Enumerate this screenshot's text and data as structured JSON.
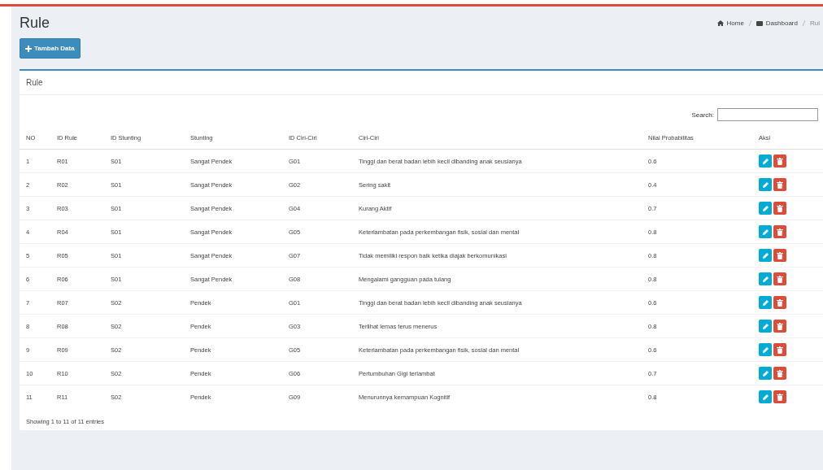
{
  "page_title": "Rule",
  "breadcrumb": [
    {
      "label": "Home"
    },
    {
      "label": "Dashboard"
    },
    {
      "label": "Rul"
    }
  ],
  "add_button": "Tambah Data",
  "box_title": "Rule",
  "search": {
    "label": "Search:"
  },
  "columns": [
    "NO",
    "ID Rule",
    "ID Stunting",
    "Stunting",
    "ID Ciri-Ciri",
    "Ciri-Ciri",
    "Nilai Probabilitas",
    "Aksi"
  ],
  "rows": [
    {
      "no": "1",
      "id_rule": "R01",
      "id_stunting": "S01",
      "stunting": "Sangat Pendek",
      "id_ciri": "G01",
      "ciri": "Tinggi dan berat badan lebih kecil dibanding anak seusianya",
      "nilai": "0.6"
    },
    {
      "no": "2",
      "id_rule": "R02",
      "id_stunting": "S01",
      "stunting": "Sangat Pendek",
      "id_ciri": "G02",
      "ciri": "Sering sakit",
      "nilai": "0.4"
    },
    {
      "no": "3",
      "id_rule": "R03",
      "id_stunting": "S01",
      "stunting": "Sangat Pendek",
      "id_ciri": "G04",
      "ciri": "Kurang Aktif",
      "nilai": "0.7"
    },
    {
      "no": "4",
      "id_rule": "R04",
      "id_stunting": "S01",
      "stunting": "Sangat Pendek",
      "id_ciri": "G05",
      "ciri": "Keterlambatan pada perkembangan fisik, sosial dan mental",
      "nilai": "0.8"
    },
    {
      "no": "5",
      "id_rule": "R05",
      "id_stunting": "S01",
      "stunting": "Sangat Pendek",
      "id_ciri": "G07",
      "ciri": "Tidak memiliki respon baik ketika diajak berkomunikasi",
      "nilai": "0.8"
    },
    {
      "no": "6",
      "id_rule": "R06",
      "id_stunting": "S01",
      "stunting": "Sangat Pendek",
      "id_ciri": "G08",
      "ciri": "Mengalami gangguan pada tulang",
      "nilai": "0.8"
    },
    {
      "no": "7",
      "id_rule": "R07",
      "id_stunting": "S02",
      "stunting": "Pendek",
      "id_ciri": "G01",
      "ciri": "Tinggi dan berat badan lebih kecil dibanding anak seusianya",
      "nilai": "0.6"
    },
    {
      "no": "8",
      "id_rule": "R08",
      "id_stunting": "S02",
      "stunting": "Pendek",
      "id_ciri": "G03",
      "ciri": "Terlihat lemas terus menerus",
      "nilai": "0.8"
    },
    {
      "no": "9",
      "id_rule": "R09",
      "id_stunting": "S02",
      "stunting": "Pendek",
      "id_ciri": "G05",
      "ciri": "Keterlambatan pada perkembangan fisik, sosial dan mental",
      "nilai": "0.6"
    },
    {
      "no": "10",
      "id_rule": "R10",
      "id_stunting": "S02",
      "stunting": "Pendek",
      "id_ciri": "G06",
      "ciri": "Pertumbuhan Gigi terlambat",
      "nilai": "0.7"
    },
    {
      "no": "11",
      "id_rule": "R11",
      "id_stunting": "S02",
      "stunting": "Pendek",
      "id_ciri": "G09",
      "ciri": "Menurunnya kemampuan Kognitif",
      "nilai": "0.8"
    }
  ],
  "footer": "Showing 1 to 11 of 11 entries"
}
